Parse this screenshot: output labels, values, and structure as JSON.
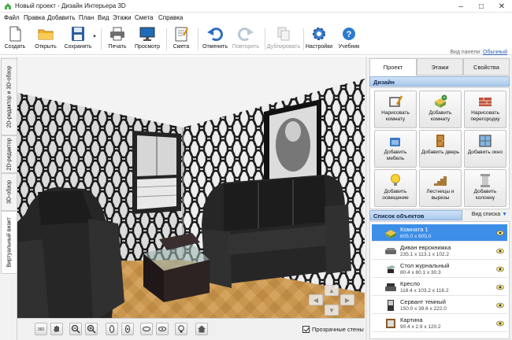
{
  "window": {
    "title": "Новый проект - Дизайн Интерьера 3D",
    "minimize": "–",
    "maximize": "□",
    "close": "✕"
  },
  "menu": [
    "Файл",
    "Правка",
    "Добавить",
    "План",
    "Вид",
    "Этажи",
    "Смета",
    "Справка"
  ],
  "toolbar": {
    "create": "Создать",
    "open": "Открыть",
    "save": "Сохранить",
    "print": "Печать",
    "preview": "Просмотр",
    "estimate": "Смета",
    "undo": "Отменить",
    "redo": "Повторить",
    "duplicate": "Дублировать",
    "settings": "Настройки",
    "tutorial": "Учебник"
  },
  "panel_view": {
    "label": "Вид панели:",
    "value": "Обычный"
  },
  "view_tabs": [
    "2D-редактор и 3D-обзор",
    "2D-редактор",
    "3D-обзор",
    "Виртуальный визит"
  ],
  "active_view_tab": 3,
  "right_tabs": [
    "Проект",
    "Этажи",
    "Свойства"
  ],
  "active_right_tab": 0,
  "design": {
    "header": "Дизайн",
    "buttons": [
      {
        "label": "Нарисовать комнату",
        "icon": "draw-room-icon"
      },
      {
        "label": "Добавить комнату",
        "icon": "add-room-icon"
      },
      {
        "label": "Нарисовать перегородку",
        "icon": "draw-partition-icon"
      },
      {
        "label": "Добавить мебель",
        "icon": "add-furniture-icon"
      },
      {
        "label": "Добавить дверь",
        "icon": "add-door-icon"
      },
      {
        "label": "Добавить окно",
        "icon": "add-window-icon"
      },
      {
        "label": "Добавить освещение",
        "icon": "add-light-icon"
      },
      {
        "label": "Лестницы и вырезы",
        "icon": "stairs-icon"
      },
      {
        "label": "Добавить колонну",
        "icon": "add-column-icon"
      }
    ]
  },
  "objects": {
    "header": "Список объектов",
    "view_list": "Вид списка",
    "items": [
      {
        "name": "Комната 1",
        "dims": "605.0 x 605.0",
        "icon": "room-icon"
      },
      {
        "name": "Диван еврокнижка",
        "dims": "235.1 x 113.1 x 102.2",
        "icon": "sofa-icon"
      },
      {
        "name": "Стол журнальный",
        "dims": "80.4 x 80.1 x 30.3",
        "icon": "table-icon"
      },
      {
        "name": "Кресло",
        "dims": "118.4 x 103.2 x 116.2",
        "icon": "armchair-icon"
      },
      {
        "name": "Сервант темный",
        "dims": "150.0 x 39.6 x 222.0",
        "icon": "cabinet-icon"
      },
      {
        "name": "Картина",
        "dims": "90.4 x 2.9 x 120.2",
        "icon": "picture-icon"
      }
    ]
  },
  "transparent_walls": {
    "label": "Прозрачные стены",
    "checked": true
  },
  "colors": {
    "accent": "#3d8ee6",
    "section_header": "#a9c8ec",
    "floor": "#c8964e",
    "furniture": "#232323"
  }
}
